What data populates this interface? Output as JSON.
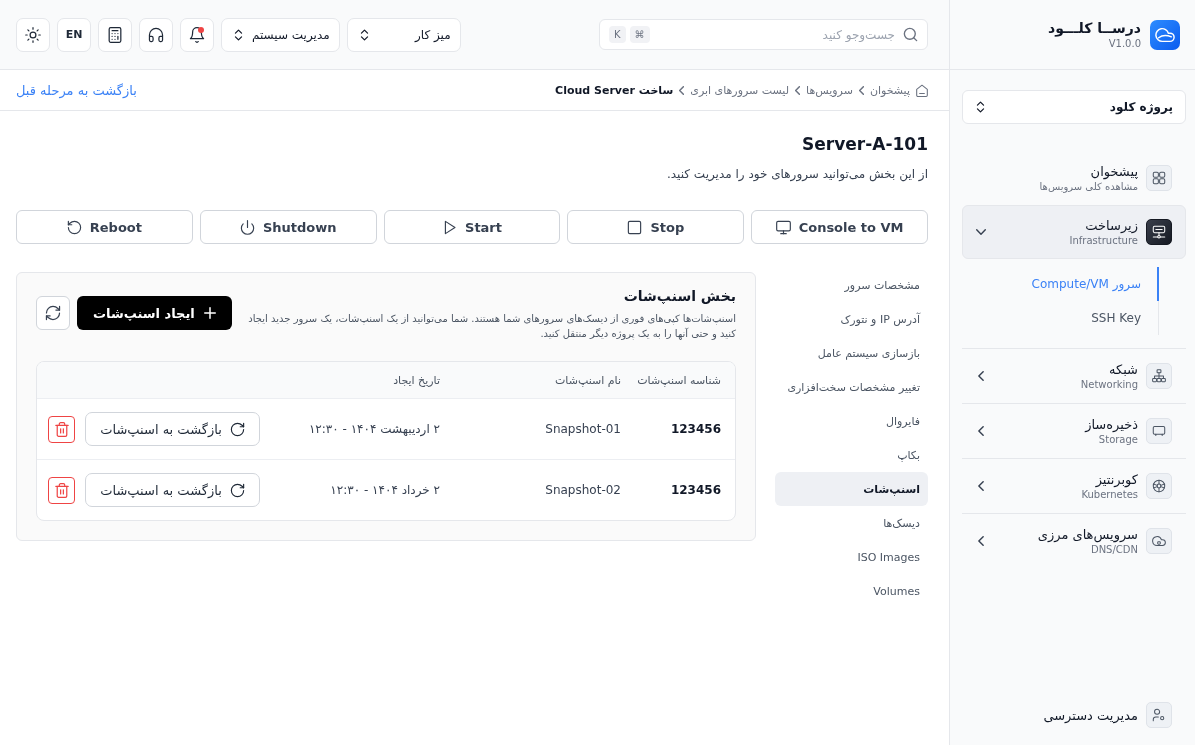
{
  "sidebar": {
    "brand": {
      "title": "درســا کلـــود",
      "version": "V1.0.0"
    },
    "project_select": {
      "value": "پروژه کلود"
    },
    "nav": [
      {
        "title": "پیشخوان",
        "subtitle": "مشاهده کلی سرویس‌ها",
        "kind": "link",
        "selected": false
      },
      {
        "title": "زیرساخت",
        "subtitle": "Infrastructure",
        "kind": "group",
        "selected": true,
        "expanded": true,
        "children": [
          {
            "label": "سرور Compute/VM",
            "selected": true
          },
          {
            "label": "SSH Key",
            "selected": false
          }
        ]
      },
      {
        "title": "شبکه",
        "subtitle": "Networking",
        "kind": "group",
        "selected": false,
        "expanded": false
      },
      {
        "title": "ذخیره‌ساز",
        "subtitle": "Storage",
        "kind": "group",
        "selected": false,
        "expanded": false
      },
      {
        "title": "کوبرنتیز",
        "subtitle": "Kubernetes",
        "kind": "group",
        "selected": false,
        "expanded": false
      },
      {
        "title": "سرویس‌های مرزی",
        "subtitle": "DNS/CDN",
        "kind": "group",
        "selected": false,
        "expanded": false
      }
    ],
    "footer_item": {
      "label": "مدیریت دسترسی"
    }
  },
  "topbar": {
    "search": {
      "placeholder": "جست‌وجو کنید",
      "keys": [
        "⌘",
        "K"
      ]
    },
    "selects": [
      {
        "value": "میز کار"
      },
      {
        "value": "مدیریت سیستم"
      }
    ],
    "notifications": {
      "unread": true
    },
    "language": "EN"
  },
  "breadcrumb": {
    "items": [
      {
        "label": "پیشخوان",
        "current": false
      },
      {
        "label": "سرویس‌ها",
        "current": false
      },
      {
        "label": "لیست سرورهای ابری",
        "current": false
      },
      {
        "label": "ساخت Cloud Server",
        "current": true
      }
    ],
    "back_link": "بازگشت به مرحله قبل"
  },
  "page": {
    "title": "Server-A-101",
    "description": "از این بخش می‌توانید سرورهای خود را مدیریت کنید."
  },
  "actions": [
    {
      "label": "Console to VM",
      "kind": "console"
    },
    {
      "label": "Stop",
      "kind": "stop"
    },
    {
      "label": "Start",
      "kind": "start"
    },
    {
      "label": "Shutdown",
      "kind": "shutdown"
    },
    {
      "label": "Reboot",
      "kind": "reboot"
    }
  ],
  "section_nav": [
    {
      "label": "مشخصات سرور",
      "selected": false
    },
    {
      "label": "آدرس IP و نتورک",
      "selected": false
    },
    {
      "label": "بازسازی سیستم عامل",
      "selected": false
    },
    {
      "label": "تغییر مشخصات سخت‌افزاری",
      "selected": false
    },
    {
      "label": "فایروال",
      "selected": false
    },
    {
      "label": "بکاپ",
      "selected": false
    },
    {
      "label": "اسنپ‌شات",
      "selected": true
    },
    {
      "label": "دیسک‌ها",
      "selected": false
    },
    {
      "label": "ISO Images",
      "selected": false
    },
    {
      "label": "Volumes",
      "selected": false
    }
  ],
  "snapshots": {
    "title": "بخش اسنپ‌شات",
    "description": "اسنپ‌شات‌ها کپی‌های فوری از دیسک‌های سرورهای شما هستند. شما می‌توانید از یک اسنپ‌شات، یک سرور جدید ایجاد کنید و حتی آنها را به یک پروژه دیگر منتقل کنید.",
    "create_button": "ایجاد اسنپ‌شات",
    "table": {
      "columns": [
        "شناسه اسنپ‌شات",
        "نام اسنپ‌شات",
        "تاریخ ایجاد"
      ],
      "rows": [
        {
          "id": "123456",
          "name": "Snapshot-01",
          "created": "۲ اردیبهشت ۱۴۰۴ - ۱۲:۳۰",
          "restore_label": "بازگشت به اسنپ‌شات"
        },
        {
          "id": "123456",
          "name": "Snapshot-02",
          "created": "۲ خرداد ۱۴۰۴ - ۱۲:۳۰",
          "restore_label": "بازگشت به اسنپ‌شات"
        }
      ]
    }
  }
}
